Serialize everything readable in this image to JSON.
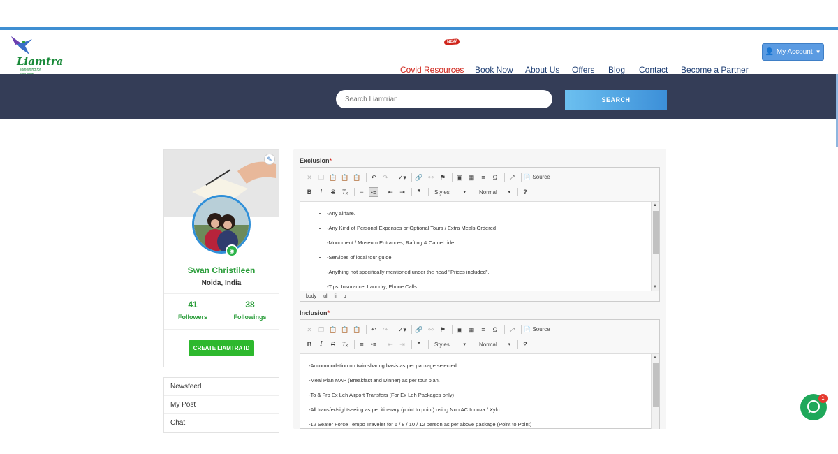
{
  "brand": {
    "name": "Liamtra",
    "tagline": "something for everyone"
  },
  "nav": {
    "new_badge": "NEW",
    "items": [
      {
        "label": "Covid Resources"
      },
      {
        "label": "Book Now"
      },
      {
        "label": "About Us"
      },
      {
        "label": "Offers"
      },
      {
        "label": "Blog"
      },
      {
        "label": "Contact"
      },
      {
        "label": "Become a Partner"
      }
    ],
    "account_label": "My Account"
  },
  "search": {
    "placeholder": "Search Liamtrian",
    "button_label": "SEARCH"
  },
  "profile": {
    "name": "Swan Christileen",
    "location": "Noida, India",
    "followers_count": "41",
    "followers_label": "Followers",
    "followings_count": "38",
    "followings_label": "Followings",
    "create_button": "CREATE LIAMTRA ID"
  },
  "menu": {
    "items": [
      "Newsfeed",
      "My Post",
      "Chat"
    ]
  },
  "editor": {
    "source_label": "Source",
    "styles_label": "Styles",
    "format_label": "Normal",
    "help_label": "?",
    "exclusion": {
      "label": "Exclusion",
      "bullets": [
        "-Any airfare.",
        "-Any Kind of Personal Expenses or Optional Tours / Extra Meals Ordered"
      ],
      "para1": "-Monument / Museum Entrances, Rafting & Camel ride.",
      "bullet3": "-Services of local tour guide.",
      "para2": "-Anything not specifically mentioned under the head \"Prices included\".",
      "para3": "-Tips, Insurance, Laundry, Phone Calls.",
      "path": [
        "body",
        "ul",
        "li",
        "p"
      ]
    },
    "inclusion": {
      "label": "Inclusion",
      "lines": [
        "-Accommodation on twin sharing basis as per package selected.",
        "-Meal Plan MAP (Breakfast and Dinner) as per tour plan.",
        "-To & Fro Ex Leh Airport Transfers (For Ex Leh Packages only)",
        "-All transfer/sightseeing as per itinerary (point to point) using Non AC Innova / Xylo .",
        "-12 Seater Force Tempo Traveler for 6 / 8 / 10 / 12 person as per above package (Point to Point)"
      ]
    }
  },
  "chat_widget": {
    "badge": "1"
  }
}
